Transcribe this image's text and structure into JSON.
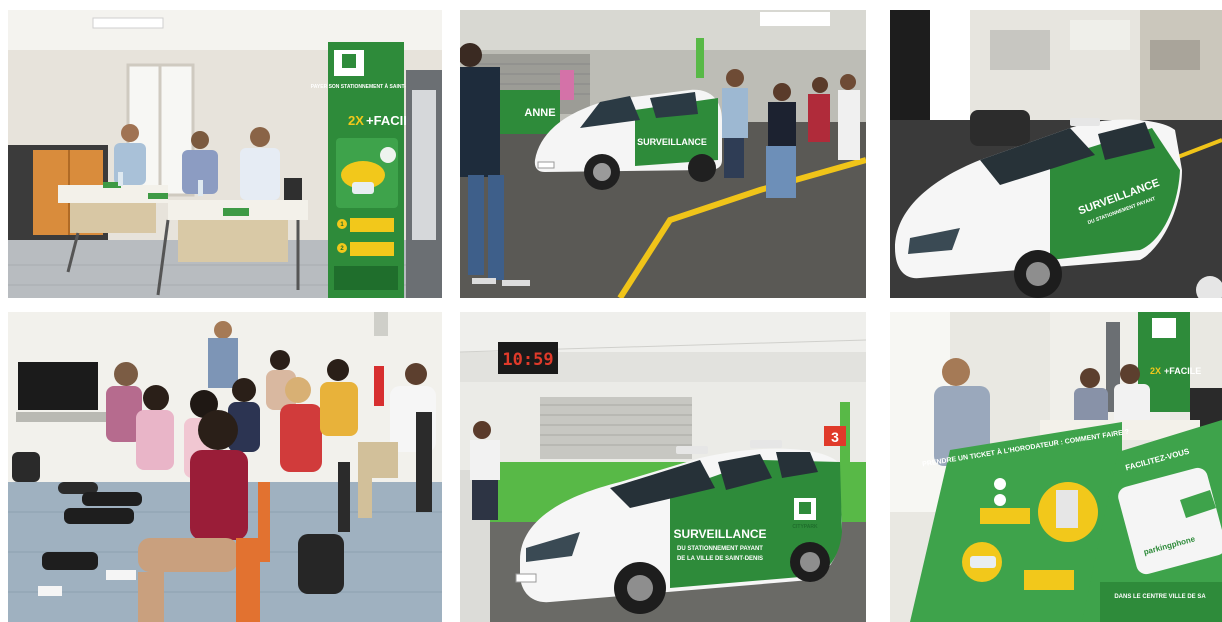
{
  "photos": [
    {
      "banner": {
        "title": "PAYER SON STATIONNEMENT À SAINT-DENIS",
        "slogan_prefix": "2X",
        "slogan_word": "+FACILE",
        "step1": "1",
        "step2": "2"
      }
    },
    {
      "sign_text": "ANNE",
      "car": {
        "line1": "SURVEILLANCE"
      }
    },
    {
      "car": {
        "line1": "SURVEILLANCE",
        "line2": "DU STATIONNEMENT PAYANT"
      }
    },
    {},
    {
      "clock": "10:59",
      "level_marker": "3",
      "car": {
        "line1": "SURVEILLANCE",
        "line2": "DU STATIONNEMENT PAYANT",
        "line3": "DE LA VILLE DE SAINT-DENIS",
        "brand": "CITYPARK"
      }
    },
    {
      "banner": {
        "slogan_prefix": "2X",
        "slogan_word": "+FACILE"
      },
      "flyer_left": {
        "headline": "PRENDRE UN TICKET À L'HORODATEUR : COMMENT FAIRE ?"
      },
      "flyer_right": {
        "headline": "FACILITEZ-VOUS",
        "app_name": "parkingphone",
        "footer": "DANS LE CENTRE VILLE DE SA"
      }
    }
  ],
  "colors": {
    "brand_green": "#2e8b3a",
    "brand_dark_green": "#1f6e2c",
    "brand_yellow": "#f2c81b",
    "line_yellow": "#f0c419",
    "wall_green": "#58b947"
  }
}
